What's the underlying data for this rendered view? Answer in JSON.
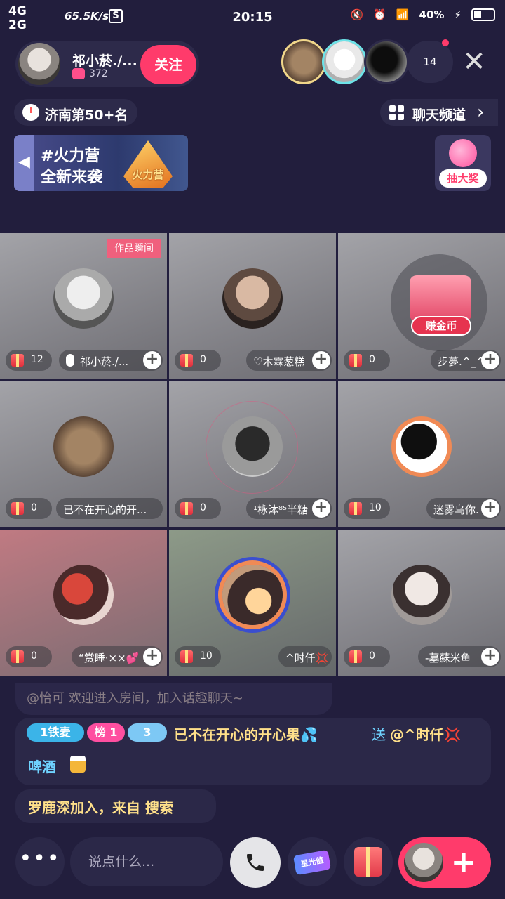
{
  "status": {
    "net1": "4G",
    "net2": "2G",
    "speed": "65.5K/s",
    "s_icon": "S",
    "time": "20:15",
    "battery": "40%",
    "icons": [
      "mute-icon",
      "alarm-icon",
      "wifi-icon",
      "charging-icon"
    ]
  },
  "host": {
    "name": "祁小菸./...",
    "fans": "372",
    "follow_label": "关注"
  },
  "viewers": {
    "count": "14"
  },
  "rank": {
    "text": "济南第50+名"
  },
  "channel": {
    "label": "聊天频道"
  },
  "banner": {
    "line1": "#火力营",
    "line2": "全新来袭",
    "art_text": "火力营"
  },
  "lottery": {
    "label": "抽大奖"
  },
  "seats": [
    {
      "gifts": "12",
      "name": "祁小菸./...",
      "badge": "作品瞬间"
    },
    {
      "gifts": "0",
      "name": "♡木霖葱糕"
    },
    {
      "gifts": "0",
      "name": "步夢.^_^",
      "chest_label": "赚金币"
    },
    {
      "gifts": "0",
      "name": "已不在开心的开..."
    },
    {
      "gifts": "0",
      "name": "¹栐泍⁸⁵半糖"
    },
    {
      "gifts": "10",
      "name": "迷雾乌你."
    },
    {
      "gifts": "0",
      "name": "“赏睡·××💕"
    },
    {
      "gifts": "10",
      "name": "^时仟💢"
    },
    {
      "gifts": "0",
      "name": "-墓蘇米鱼"
    }
  ],
  "chat": {
    "msg1": "@怡可 欢迎进入房间，加入话趣聊天~",
    "badge_tie": "1铁麦",
    "badge_bang": "榜 1",
    "badge_dia": "3",
    "msg2": "已不在开心的开心果💦",
    "msg2_send": "送",
    "msg2_target": "@^时仟💢",
    "msg2_gift": "啤酒",
    "msg3": "罗鹿深加入，来自 搜索"
  },
  "bottom": {
    "more": "•••",
    "input_placeholder": "说点什么...",
    "star_label": "星光值"
  },
  "colors": {
    "accent": "#ff3b6b",
    "background": "#221e3d",
    "chat_gold": "#ffe08a",
    "chat_blue": "#6fd3ff"
  }
}
